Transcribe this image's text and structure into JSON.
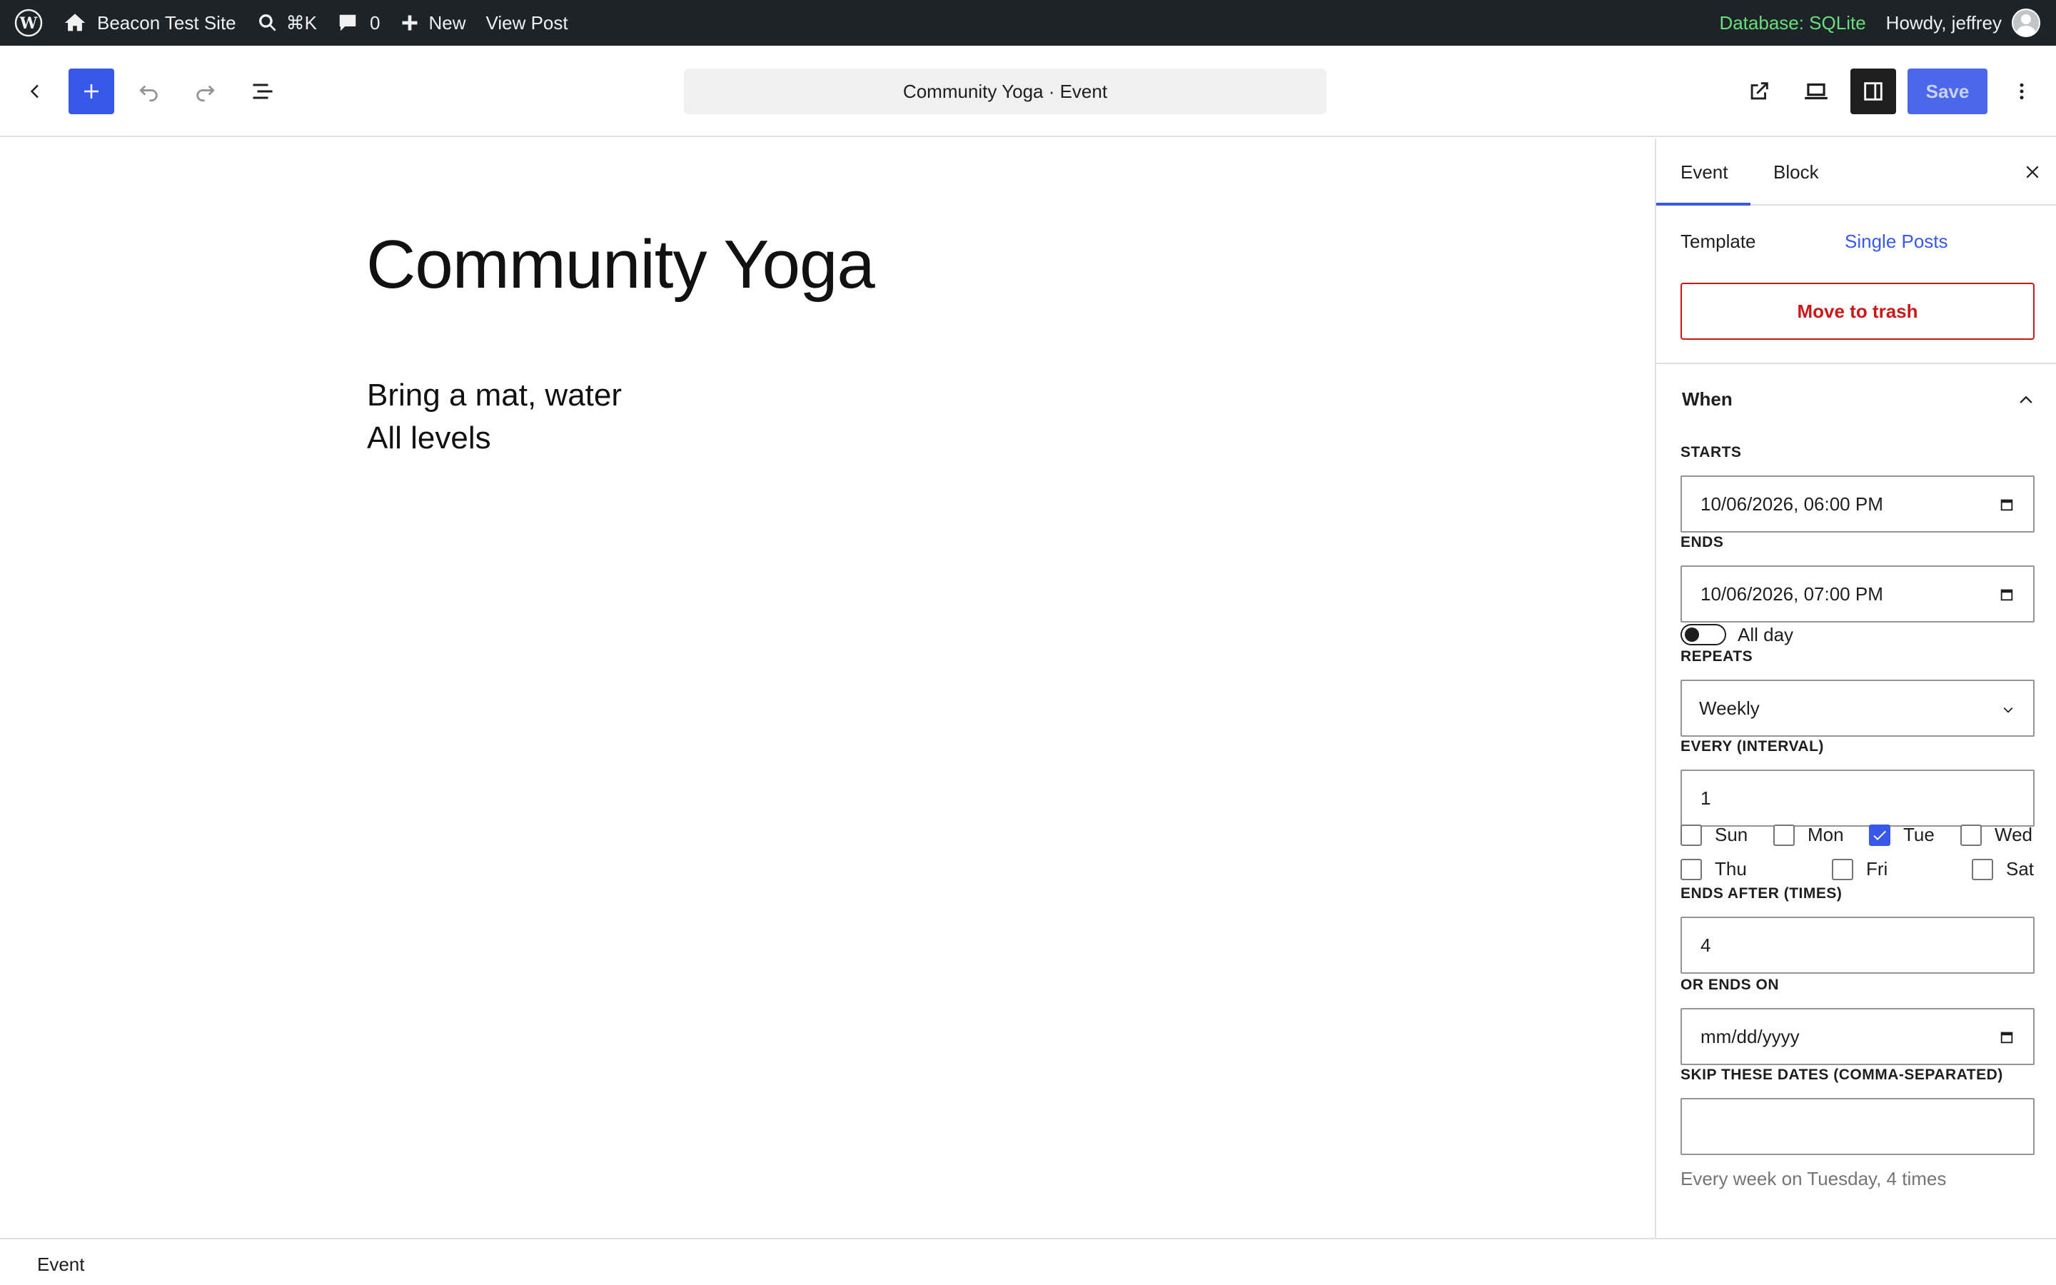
{
  "adminbar": {
    "site_name": "Beacon Test Site",
    "search_shortcut": "⌘K",
    "comments_count": "0",
    "new_label": "New",
    "view_post_label": "View Post",
    "database_label": "Database: SQLite",
    "greeting": "Howdy, jeffrey"
  },
  "header": {
    "document_title": "Community Yoga · Event",
    "save_label": "Save"
  },
  "post": {
    "title": "Community Yoga",
    "body_line1": "Bring a mat, water",
    "body_line2": "All levels"
  },
  "sidebar": {
    "tabs": [
      {
        "label": "Event",
        "active": true
      },
      {
        "label": "Block",
        "active": false
      }
    ],
    "template_label": "Template",
    "template_value": "Single Posts",
    "trash_label": "Move to trash",
    "when_panel": {
      "title": "When",
      "starts_label": "STARTS",
      "starts_value": "10/06/2026, 06:00 PM",
      "ends_label": "ENDS",
      "ends_value": "10/06/2026, 07:00 PM",
      "allday_label": "All day",
      "allday_on": false,
      "repeats_label": "REPEATS",
      "repeats_value": "Weekly",
      "interval_label": "EVERY (INTERVAL)",
      "interval_value": "1",
      "days": [
        {
          "label": "Sun",
          "checked": false
        },
        {
          "label": "Mon",
          "checked": false
        },
        {
          "label": "Tue",
          "checked": true
        },
        {
          "label": "Wed",
          "checked": false
        },
        {
          "label": "Thu",
          "checked": false
        },
        {
          "label": "Fri",
          "checked": false
        },
        {
          "label": "Sat",
          "checked": false
        }
      ],
      "ends_after_label": "ENDS AFTER (TIMES)",
      "ends_after_value": "4",
      "ends_on_label": "OR ENDS ON",
      "ends_on_placeholder": "mm/dd/yyyy",
      "skip_label": "SKIP THESE DATES (COMMA-SEPARATED)",
      "skip_value": "",
      "summary": "Every week on Tuesday, 4 times"
    }
  },
  "footer": {
    "breadcrumb": "Event"
  },
  "colors": {
    "accent": "#3858e9",
    "danger": "#cc1818",
    "adminbar_bg": "#1d2327",
    "db_green": "#68de7c"
  }
}
